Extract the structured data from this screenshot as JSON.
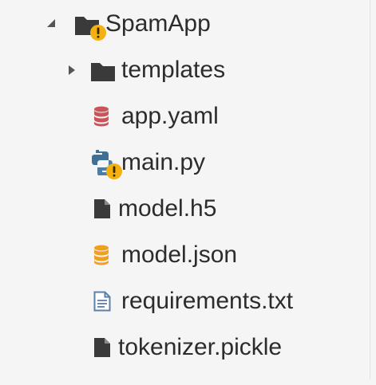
{
  "file_tree": {
    "root": {
      "name": "SpamApp",
      "expanded": true,
      "icon": "folder-icon",
      "badge": "warning-badge-icon"
    },
    "items": [
      {
        "name": "templates",
        "kind": "folder",
        "expanded": false,
        "icon": "folder-icon"
      },
      {
        "name": "app.yaml",
        "kind": "file",
        "icon": "database-icon",
        "icon_color": "#c9545a"
      },
      {
        "name": "main.py",
        "kind": "file",
        "icon": "python-icon",
        "icon_color": "#3f6f93",
        "badge": "warning-badge-icon"
      },
      {
        "name": "model.h5",
        "kind": "file",
        "icon": "file-icon",
        "icon_color": "#3a3a3a"
      },
      {
        "name": "model.json",
        "kind": "file",
        "icon": "database-icon",
        "icon_color": "#f0a020"
      },
      {
        "name": "requirements.txt",
        "kind": "file",
        "icon": "text-file-icon",
        "icon_color": "#5d7fa8"
      },
      {
        "name": "tokenizer.pickle",
        "kind": "file",
        "icon": "file-icon",
        "icon_color": "#3a3a3a"
      }
    ]
  },
  "colors": {
    "background": "#f5f5f5",
    "text": "#2c2c2c",
    "warning_badge": "#f3b111"
  }
}
